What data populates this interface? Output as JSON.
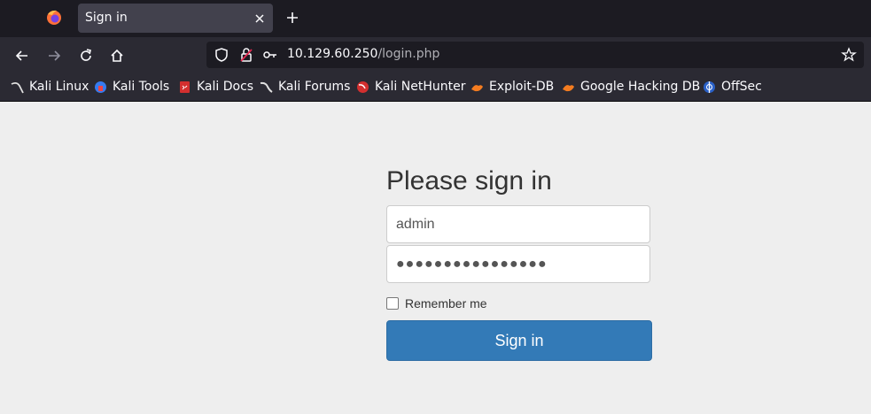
{
  "browser": {
    "tab": {
      "title": "Sign in"
    },
    "url": {
      "host": "10.129.60.250",
      "path": "/login.php"
    },
    "bookmarks": [
      {
        "label": "Kali Linux",
        "icon": "kali-dragon-icon"
      },
      {
        "label": "Kali Tools",
        "icon": "kali-tools-icon"
      },
      {
        "label": "Kali Docs",
        "icon": "kali-docs-icon"
      },
      {
        "label": "Kali Forums",
        "icon": "kali-forums-icon"
      },
      {
        "label": "Kali NetHunter",
        "icon": "kali-nethunter-icon"
      },
      {
        "label": "Exploit-DB",
        "icon": "exploit-db-icon"
      },
      {
        "label": "Google Hacking DB",
        "icon": "google-hacking-db-icon"
      },
      {
        "label": "OffSec",
        "icon": "offsec-icon"
      }
    ]
  },
  "page": {
    "heading": "Please sign in",
    "username_value": "admin",
    "password_masked": "●●●●●●●●●●●●●●●●",
    "remember_label": "Remember me",
    "remember_checked": false,
    "signin_label": "Sign in"
  },
  "colors": {
    "primary": "#337ab7",
    "background": "#eeeeee",
    "chrome_dark": "#1c1b22",
    "chrome": "#2b2a33"
  }
}
